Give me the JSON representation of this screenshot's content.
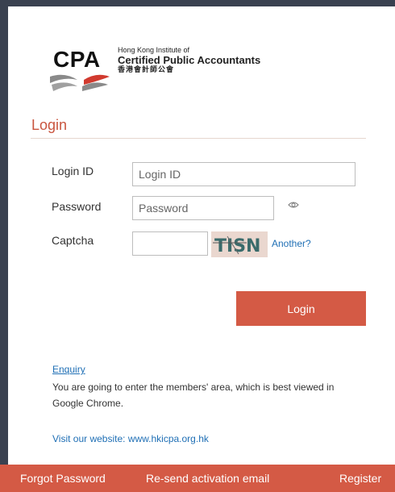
{
  "logo": {
    "mark": "CPA",
    "line1": "Hong Kong Institute of",
    "line2": "Certified Public Accountants",
    "line3": "香港會計師公會"
  },
  "login_section": {
    "title": "Login"
  },
  "form": {
    "login_id": {
      "label": "Login ID",
      "placeholder": "Login ID",
      "value": ""
    },
    "password": {
      "label": "Password",
      "placeholder": "Password",
      "value": ""
    },
    "captcha": {
      "label": "Captcha",
      "value": "",
      "image_text": "TISN",
      "another_label": "Another?"
    }
  },
  "actions": {
    "login_label": "Login"
  },
  "info": {
    "enquiry_label": "Enquiry",
    "notice": "You are going to enter the members' area, which is best viewed in Google Chrome.",
    "visit": "Visit our website: www.hkicpa.org.hk"
  },
  "footer": {
    "forgot_password": "Forgot Password",
    "resend_activation": "Re-send activation email",
    "register": "Register"
  },
  "colors": {
    "accent": "#d45a45",
    "title": "#c9553f",
    "link": "#1f6fb5",
    "frame": "#3a4150"
  },
  "icons": {
    "password_toggle": "eye-icon"
  }
}
